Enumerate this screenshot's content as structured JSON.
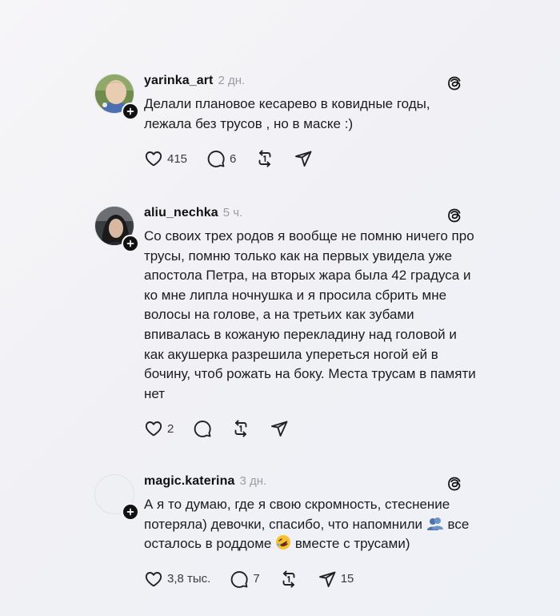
{
  "posts": [
    {
      "username": "yarinka_art",
      "time": "2 дн.",
      "text": "Делали плановое кесарево в ковидные годы, лежала без трусов , но в маске :)",
      "likes": "415",
      "replies": "6",
      "reposts": "",
      "shares": ""
    },
    {
      "username": "aliu_nechka",
      "time": "5 ч.",
      "text": "Со своих трех родов я вообще не помню ничего про трусы, помню только как на первых увидела уже апостола Петра, на вторых жара была 42 градуса и ко мне липла ночнушка и я просила сбрить мне волосы на голове, а на третьих как зубами впивалась в кожаную перекладину над головой и как акушерка разрешила упереться ногой ей в бочину, чтоб рожать на боку. Места трусам в памяти нет",
      "likes": "2",
      "replies": "",
      "reposts": "",
      "shares": ""
    },
    {
      "username": "magic.katerina",
      "time": "3 дн.",
      "text_part1": "А я то думаю, где я свою скромность, стеснение потеряла) девочки, спасибо, что напомнили",
      "text_part2": "все осталось в роддоме",
      "text_part3": "вместе с трусами)",
      "likes": "3,8 тыс.",
      "replies": "7",
      "reposts": "",
      "shares": "15"
    }
  ],
  "icons": {
    "like": "heart-icon",
    "reply": "speech-bubble-icon",
    "repost": "repost-icon",
    "share": "send-icon",
    "threads": "threads-logo-icon",
    "follow": "plus-icon"
  },
  "colors": {
    "background": "#f3f3f6",
    "text": "#1c1c1f",
    "muted": "#9b9ba3",
    "badge": "#111111"
  }
}
